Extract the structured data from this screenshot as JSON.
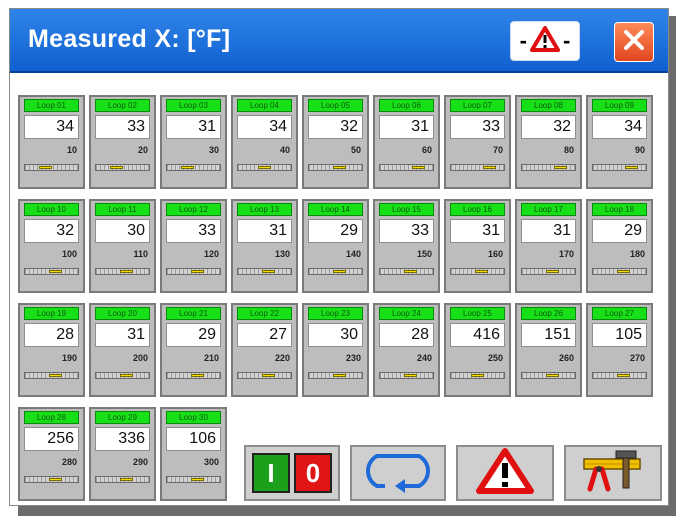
{
  "window": {
    "title": "Measured X: [°F]"
  },
  "icons": {
    "alarm": "alarm-warning-icon",
    "close": "close-icon",
    "start_stop": "start-stop-icon",
    "cycle": "cycle-icon",
    "warning": "warning-icon",
    "tools": "tools-icon"
  },
  "io": {
    "on_label": "I",
    "off_label": "0"
  },
  "alarm_dash": "-",
  "colors": {
    "title_bar": "#1a6fe0",
    "label_green": "#18e018",
    "marker_yellow": "#f2e000",
    "close_orange": "#f06a3a",
    "warning_red": "#e01010",
    "cycle_blue": "#1e6ad8"
  },
  "loops": [
    {
      "label": "Loop 01",
      "value": "34",
      "setpoint": "10",
      "marker": 0.35
    },
    {
      "label": "Loop 02",
      "value": "33",
      "setpoint": "20",
      "marker": 0.35
    },
    {
      "label": "Loop 03",
      "value": "31",
      "setpoint": "30",
      "marker": 0.35
    },
    {
      "label": "Loop 04",
      "value": "34",
      "setpoint": "40",
      "marker": 0.5
    },
    {
      "label": "Loop 05",
      "value": "32",
      "setpoint": "50",
      "marker": 0.6
    },
    {
      "label": "Loop 06",
      "value": "31",
      "setpoint": "60",
      "marker": 0.8
    },
    {
      "label": "Loop 07",
      "value": "33",
      "setpoint": "70",
      "marker": 0.8
    },
    {
      "label": "Loop 08",
      "value": "32",
      "setpoint": "80",
      "marker": 0.8
    },
    {
      "label": "Loop 09",
      "value": "34",
      "setpoint": "90",
      "marker": 0.8
    },
    {
      "label": "Loop 10",
      "value": "32",
      "setpoint": "100",
      "marker": 0.6
    },
    {
      "label": "Loop 11",
      "value": "30",
      "setpoint": "110",
      "marker": 0.6
    },
    {
      "label": "Loop 12",
      "value": "33",
      "setpoint": "120",
      "marker": 0.6
    },
    {
      "label": "Loop 13",
      "value": "31",
      "setpoint": "130",
      "marker": 0.6
    },
    {
      "label": "Loop 14",
      "value": "29",
      "setpoint": "140",
      "marker": 0.6
    },
    {
      "label": "Loop 15",
      "value": "33",
      "setpoint": "150",
      "marker": 0.6
    },
    {
      "label": "Loop 16",
      "value": "31",
      "setpoint": "160",
      "marker": 0.6
    },
    {
      "label": "Loop 17",
      "value": "31",
      "setpoint": "170",
      "marker": 0.6
    },
    {
      "label": "Loop 18",
      "value": "29",
      "setpoint": "180",
      "marker": 0.6
    },
    {
      "label": "Loop 19",
      "value": "28",
      "setpoint": "190",
      "marker": 0.6
    },
    {
      "label": "Loop 20",
      "value": "31",
      "setpoint": "200",
      "marker": 0.6
    },
    {
      "label": "Loop 21",
      "value": "29",
      "setpoint": "210",
      "marker": 0.6
    },
    {
      "label": "Loop 22",
      "value": "27",
      "setpoint": "220",
      "marker": 0.6
    },
    {
      "label": "Loop 23",
      "value": "30",
      "setpoint": "230",
      "marker": 0.6
    },
    {
      "label": "Loop 24",
      "value": "28",
      "setpoint": "240",
      "marker": 0.6
    },
    {
      "label": "Loop 25",
      "value": "416",
      "setpoint": "250",
      "marker": 0.5
    },
    {
      "label": "Loop 26",
      "value": "151",
      "setpoint": "260",
      "marker": 0.6
    },
    {
      "label": "Loop 27",
      "value": "105",
      "setpoint": "270",
      "marker": 0.6
    },
    {
      "label": "Loop 28",
      "value": "256",
      "setpoint": "280",
      "marker": 0.6
    },
    {
      "label": "Loop 29",
      "value": "336",
      "setpoint": "290",
      "marker": 0.6
    },
    {
      "label": "Loop 30",
      "value": "106",
      "setpoint": "300",
      "marker": 0.6
    }
  ]
}
